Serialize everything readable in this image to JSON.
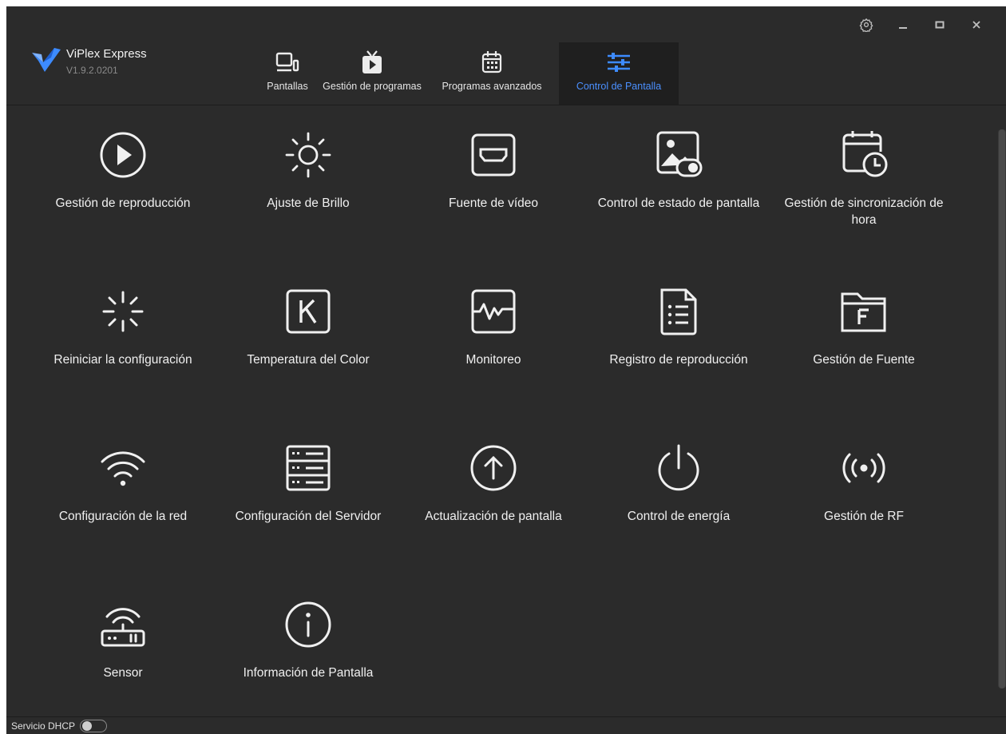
{
  "app": {
    "name": "ViPlex Express",
    "version": "V1.9.2.0201"
  },
  "colors": {
    "background": "#2b2b2b",
    "active_tab_bg": "#1f1f1f",
    "accent": "#3d8bff"
  },
  "tabs": [
    {
      "label": "Pantallas",
      "icon": "monitor-icon",
      "active": false
    },
    {
      "label": "Gestión de programas",
      "icon": "tv-play-icon",
      "active": false
    },
    {
      "label": "Programas avanzados",
      "icon": "calendar-icon",
      "active": false
    },
    {
      "label": "Control de Pantalla",
      "icon": "sliders-icon",
      "active": true
    }
  ],
  "tiles": [
    {
      "label": "Gestión de reproducción",
      "icon": "play-circle-icon"
    },
    {
      "label": "Ajuste de Brillo",
      "icon": "brightness-icon"
    },
    {
      "label": "Fuente de vídeo",
      "icon": "hdmi-icon"
    },
    {
      "label": "Control de estado de pantalla",
      "icon": "image-toggle-icon"
    },
    {
      "label": "Gestión de sincronización de hora",
      "icon": "calendar-clock-icon"
    },
    {
      "label": "Reiniciar la configuración",
      "icon": "loading-spinner-icon"
    },
    {
      "label": "Temperatura del Color",
      "icon": "k-box-icon"
    },
    {
      "label": "Monitoreo",
      "icon": "pulse-monitor-icon"
    },
    {
      "label": "Registro de reproducción",
      "icon": "list-document-icon"
    },
    {
      "label": "Gestión de Fuente",
      "icon": "font-folder-icon"
    },
    {
      "label": "Configuración de la red",
      "icon": "wifi-icon"
    },
    {
      "label": "Configuración del Servidor",
      "icon": "server-icon"
    },
    {
      "label": "Actualización de pantalla",
      "icon": "upload-circle-icon"
    },
    {
      "label": "Control de energía",
      "icon": "power-icon"
    },
    {
      "label": "Gestión de RF",
      "icon": "radio-signal-icon"
    },
    {
      "label": "Sensor",
      "icon": "router-sensor-icon"
    },
    {
      "label": "Información de Pantalla",
      "icon": "info-circle-icon"
    }
  ],
  "footer": {
    "dhcp_label": "Servicio DHCP",
    "dhcp_enabled": false
  }
}
